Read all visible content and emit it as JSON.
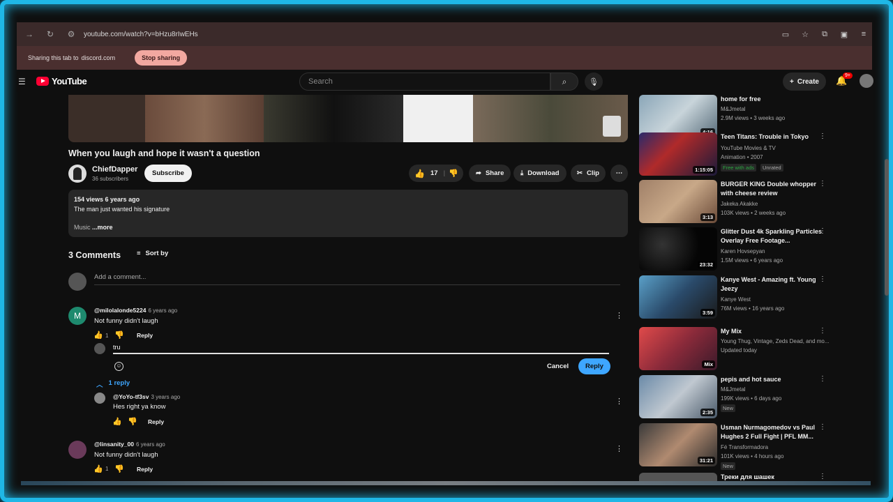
{
  "browser": {
    "url": "youtube.com/watch?v=bHzu8rIwEHs",
    "share_text": "Sharing this tab to",
    "share_host": "discord.com",
    "stop_sharing": "Stop sharing"
  },
  "header": {
    "logo_text": "YouTube",
    "search_placeholder": "Search",
    "create_label": "Create",
    "notif_count": "9+"
  },
  "video": {
    "title": "When you laugh and hope it wasn't a question",
    "channel": "ChiefDapper",
    "subscribers": "36 subscribers",
    "subscribe_label": "Subscribe",
    "likes": "17",
    "share_label": "Share",
    "download_label": "Download",
    "clip_label": "Clip",
    "views_line": "154 views  6 years ago",
    "description": "The man just wanted his signature",
    "desc_truncated": "Music",
    "more_label": "...more"
  },
  "comments": {
    "count_label": "3 Comments",
    "sort_label": "Sort by",
    "add_placeholder": "Add a comment...",
    "items": [
      {
        "handle": "@milolalonde5224",
        "ago": "6 years ago",
        "text": "Not funny didn't laugh",
        "likes": "1",
        "reply_label": "Reply",
        "avatar_letter": "M"
      },
      {
        "handle": "@linsanity_00",
        "ago": "6 years ago",
        "text": "Not funny didn't laugh",
        "likes": "1",
        "reply_label": "Reply"
      }
    ],
    "reply_box": {
      "typed": "tru",
      "cancel": "Cancel",
      "submit": "Reply"
    },
    "replies_toggle": "1 reply",
    "reply": {
      "handle": "@YoYo-tf3sv",
      "ago": "3 years ago",
      "text": "Hes right ya know",
      "reply_label": "Reply"
    }
  },
  "sidebar": [
    {
      "title": "home  for free",
      "channel": "M&Jmetal",
      "meta": "2.9M views • 3 weeks ago",
      "duration": "4:16"
    },
    {
      "title": "Teen Titans: Trouble in Tokyo",
      "channel": "YouTube Movies & TV",
      "meta": "Animation • 2007",
      "badge1": "Free with ads",
      "badge2": "Unrated",
      "duration": "1:15:05"
    },
    {
      "title": "BURGER KING Double whopper with cheese review",
      "channel": "Jakeka Akakke",
      "meta": "103K views • 2 weeks ago",
      "duration": "3:13"
    },
    {
      "title": "Glitter Dust 4k Sparkling Particles Overlay Free Footage...",
      "channel": "Karen Hovsepyan",
      "meta": "1.5M views • 6 years ago",
      "duration": "23:32"
    },
    {
      "title": "Kanye West - Amazing ft. Young Jeezy",
      "channel": "Kanye West",
      "meta": "76M views • 16 years ago",
      "duration": "3:59"
    },
    {
      "title": "My Mix",
      "channel": "Young Thug, Vintage, Zeds Dead, and mo...",
      "meta": "Updated today",
      "duration": "Mix"
    },
    {
      "title": "pepis and hot sauce",
      "channel": "M&Jmetal",
      "meta": "199K views • 6 days ago",
      "badge1": "New",
      "duration": "2:35"
    },
    {
      "title": "Usman Nurmagomedov vs Paul Hughes 2 Full Fight | PFL MM...",
      "channel": "Fé Transformadora",
      "meta": "101K views • 4 hours ago",
      "badge1": "New",
      "duration": "31:21"
    },
    {
      "title": "Треки для шашек"
    }
  ]
}
